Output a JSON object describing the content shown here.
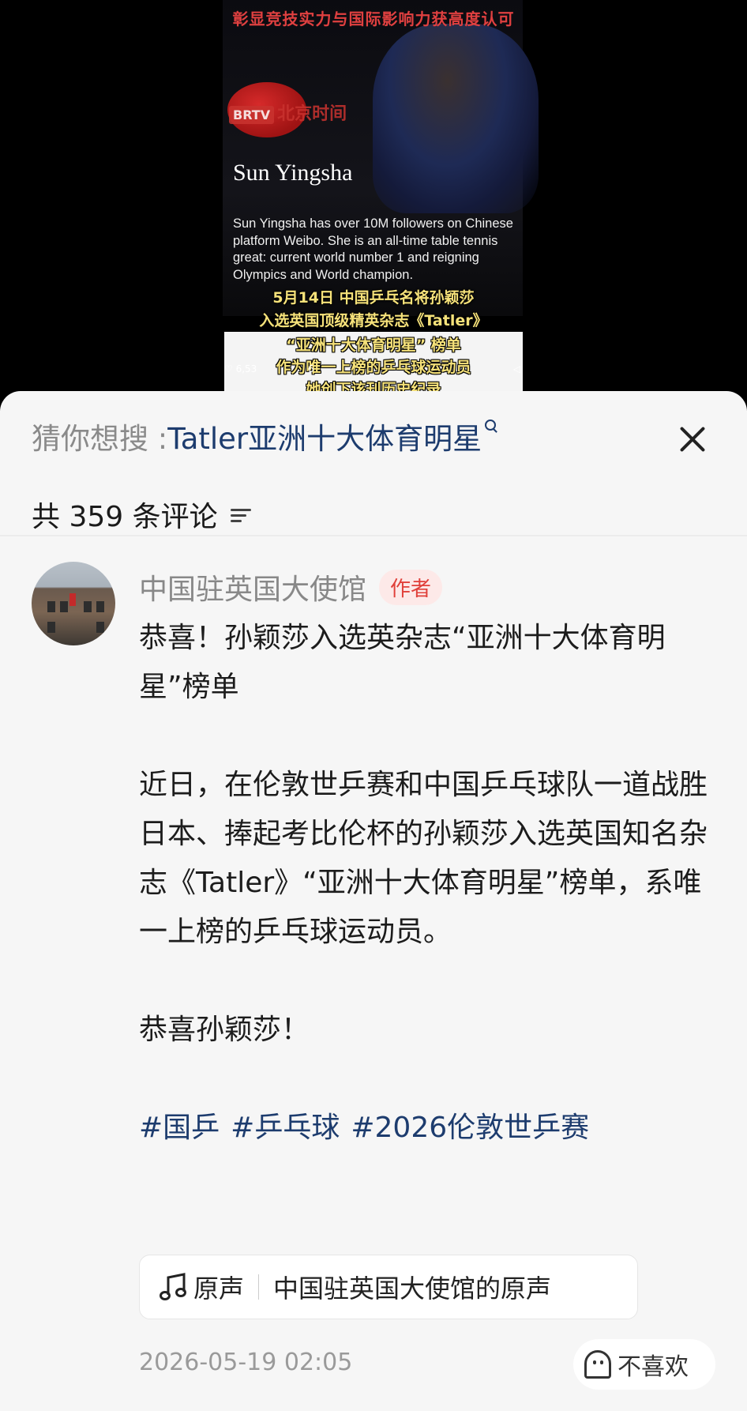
{
  "video": {
    "banner_top": "彰显竞技实力与国际影响力获高度认可",
    "watermark_tag": "BRTV",
    "watermark_text": "北京时间",
    "poster_name": "Sun Yingsha",
    "poster_desc": "Sun Yingsha has over 10M followers on Chinese platform Weibo. She is an all-time table tennis great: current world number 1 and reigning Olympics and World champion.",
    "caption_1": "5月14日 中国乒乓名将孙颖莎",
    "caption_2": "入选英国顶级精英杂志《Tatler》",
    "caption_3": "“亚洲十大体育明星” 榜单",
    "caption_4": "作为唯一上榜的乒乓球运动员",
    "caption_5": "她创下该刊历史纪录",
    "stat_left": "6,53",
    "stat_mid": "6"
  },
  "search": {
    "prefix": "猜你想搜 : ",
    "term": "Tatler亚洲十大体育明星"
  },
  "comments": {
    "count_label": "共 359 条评论"
  },
  "comment": {
    "author": "中国驻英国大使馆",
    "badge": "作者",
    "line1": "恭喜！孙颖莎入选英杂志“亚洲十大体育明星”榜单",
    "para2": "近日，在伦敦世乒赛和中国乒乓球队一道战胜日本、捧起考比伦杯的孙颖莎入选英国知名杂志《Tatler》“亚洲十大体育明星”榜单，系唯一上榜的乒乓球运动员。",
    "para3": "恭喜孙颖莎！",
    "tags": [
      "#国乒",
      "#乒乓球",
      "#2026伦敦世乒赛"
    ],
    "audio_label": "原声",
    "audio_title": "中国驻英国大使馆的原声",
    "timestamp": "2026-05-19 02:05",
    "dislike_label": "不喜欢"
  },
  "colors": {
    "link_blue": "#1d3c6e",
    "badge_red": "#e0403a",
    "caption_yellow": "#f6e27a"
  }
}
